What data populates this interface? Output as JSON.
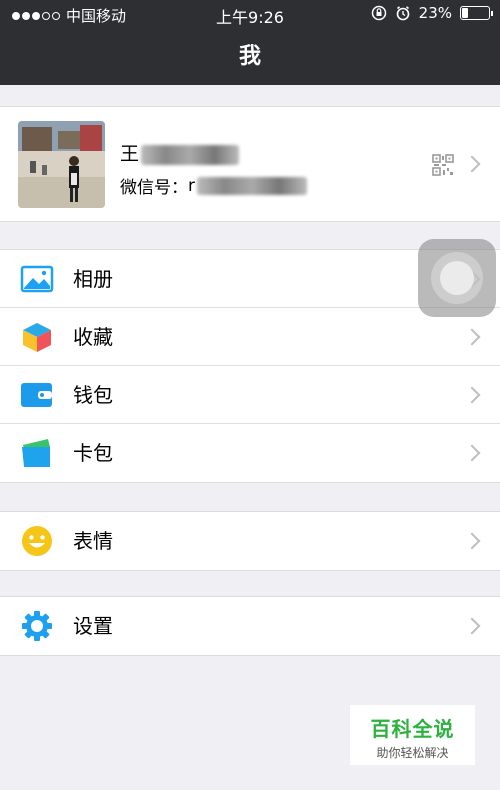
{
  "status_bar": {
    "carrier": "中国移动",
    "time": "上午9:26",
    "battery": "23%",
    "battery_level": 0.23,
    "signal_bars": 3
  },
  "nav": {
    "title": "我"
  },
  "profile": {
    "name": "王",
    "wechat_id_label": "微信号：",
    "wechat_id_value": "r",
    "qr_icon": "qr-code-icon"
  },
  "menu": {
    "album": {
      "label": "相册",
      "icon": "photo-album-icon",
      "color": "#1da1f2"
    },
    "favorites": {
      "label": "收藏",
      "icon": "cube-favorites-icon"
    },
    "wallet": {
      "label": "钱包",
      "icon": "wallet-icon",
      "color": "#1c9bea"
    },
    "cards": {
      "label": "卡包",
      "icon": "card-bag-icon"
    },
    "stickers": {
      "label": "表情",
      "icon": "smiley-icon",
      "color": "#f5c518"
    },
    "settings": {
      "label": "设置",
      "icon": "gear-icon",
      "color": "#1ea0f0"
    }
  },
  "watermark": {
    "title": "百科全说",
    "subtitle": "助你轻松解决"
  }
}
